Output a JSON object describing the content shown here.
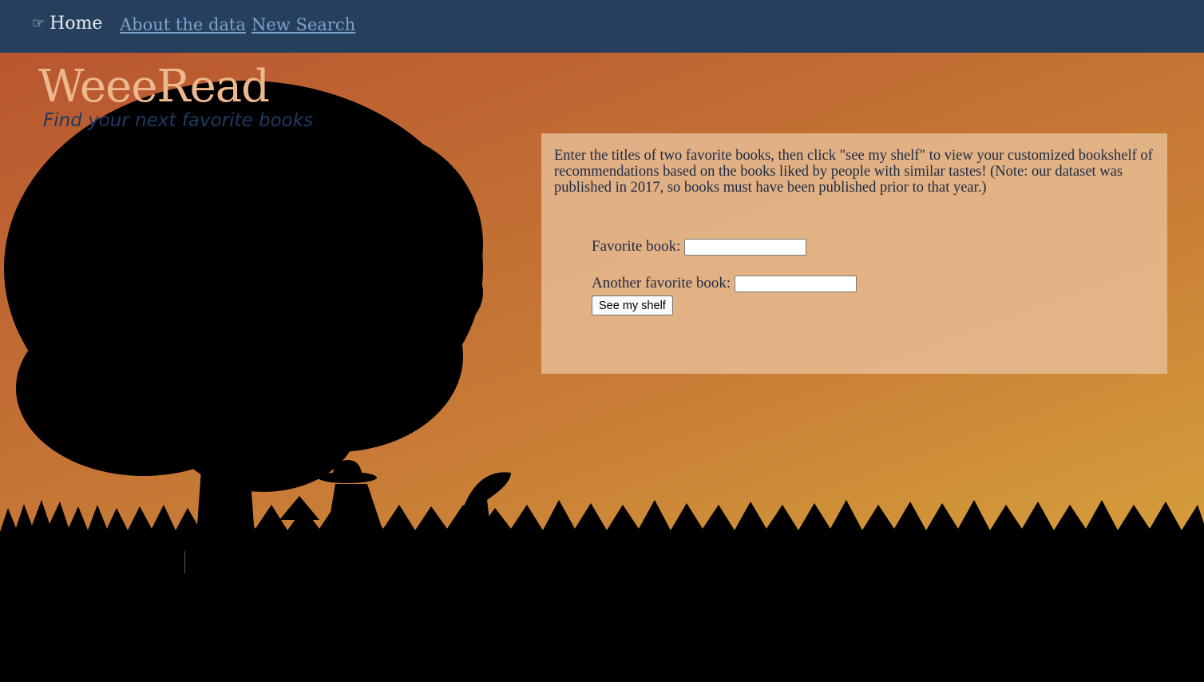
{
  "nav": {
    "home_icon": "☞",
    "home_label": "Home",
    "about_label": "About the data",
    "new_search_label": "New Search"
  },
  "header": {
    "title": "WeeeRead",
    "subtitle": "Find your next favorite books"
  },
  "panel": {
    "intro": "Enter the titles of two favorite books, then click \"see my shelf\" to view your customized bookshelf of recommendations based on the books liked by people with similar tastes! (Note: our dataset was published in 2017, so books must have been published prior to that year.)",
    "book1_label": "Favorite book:",
    "book1_value": "",
    "book2_label": "Another favorite book:",
    "book2_value": "",
    "submit_label": "See my shelf"
  },
  "colors": {
    "navbar": "#263f5c",
    "title": "#ecb88f",
    "subtitle": "#1e3a62",
    "link": "#7aa3cc"
  }
}
